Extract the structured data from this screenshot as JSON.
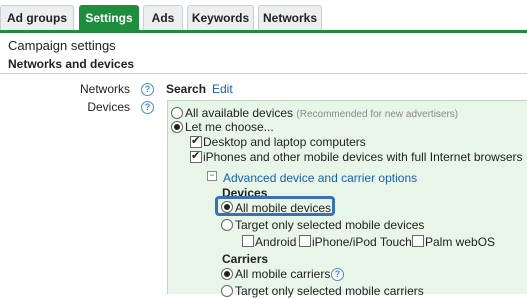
{
  "tabs": [
    {
      "label": "Ad groups",
      "active": false
    },
    {
      "label": "Settings",
      "active": true
    },
    {
      "label": "Ads",
      "active": false
    },
    {
      "label": "Keywords",
      "active": false
    },
    {
      "label": "Networks",
      "active": false
    }
  ],
  "page": {
    "title": "Campaign settings",
    "section": "Networks and devices"
  },
  "networks": {
    "label": "Networks",
    "value": "Search",
    "edit_label": "Edit"
  },
  "devices": {
    "label": "Devices",
    "all_available": {
      "label": "All available devices",
      "hint": "(Recommended for new advertisers)",
      "selected": false
    },
    "let_me_choose": {
      "label": "Let me choose...",
      "selected": true
    },
    "desktop": {
      "label": "Desktop and laptop computers",
      "checked": true
    },
    "iphones": {
      "label": "iPhones and other mobile devices with full Internet browsers",
      "checked": true
    },
    "advanced_link": "Advanced device and carrier options",
    "devices_heading": "Devices",
    "all_mobile_devices": {
      "label": "All mobile devices",
      "selected": true
    },
    "target_selected_devices": {
      "label": "Target only selected mobile devices",
      "selected": false
    },
    "device_options": [
      {
        "label": "Android",
        "checked": false
      },
      {
        "label": "iPhone/iPod Touch",
        "checked": false
      },
      {
        "label": "Palm webOS",
        "checked": false
      }
    ],
    "carriers_heading": "Carriers",
    "all_mobile_carriers": {
      "label": "All mobile carriers",
      "selected": true
    },
    "target_selected_carriers": {
      "label": "Target only selected mobile carriers",
      "selected": false
    }
  },
  "help_icon": "?",
  "collapse_icon": "−",
  "colors": {
    "accent": "#1e8e3e",
    "link": "#1a5fb4",
    "panel": "#e8f5e9",
    "highlight": "#3b6fb6"
  }
}
